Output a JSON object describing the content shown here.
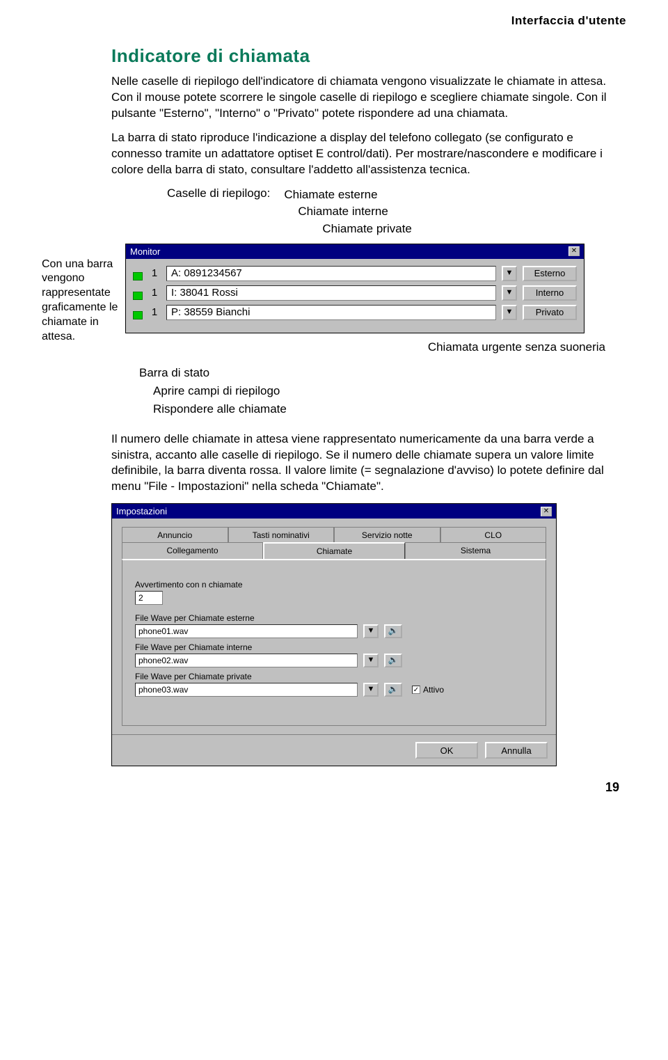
{
  "header": {
    "chapter": "Interfaccia d'utente"
  },
  "section": {
    "title": "Indicatore di chiamata"
  },
  "paragraph1": "Nelle caselle di riepilogo dell'indicatore di chiamata vengono visualizzate le chiamate in attesa. Con il mouse potete scorrere le singole caselle di riepilogo e scegliere chiamate singole. Con il pulsante \"Esterno\", \"Interno\" o \"Privato\" potete rispondere ad una chiamata.",
  "paragraph2": "La barra di stato riproduce l'indicazione a display del telefono collegato (se configurato e connesso tramite un adattatore optiset E control/dati). Per mostrare/nascondere e modificare i colore della barra di stato, consultare l'addetto all'assistenza tecnica.",
  "caselle": {
    "label": "Caselle di riepilogo:",
    "esterne": "Chiamate esterne",
    "interne": "Chiamate interne",
    "private": "Chiamate private"
  },
  "side_note": "Con una barra vengono rappresentate graficamente le chiamate in attesa.",
  "monitor": {
    "title": "Monitor",
    "close_glyph": "✕",
    "dd_glyph": "▼",
    "rows": [
      {
        "count": "1",
        "text": "A: 0891234567",
        "button": "Esterno"
      },
      {
        "count": "1",
        "text": "I: 38041   Rossi",
        "button": "Interno"
      },
      {
        "count": "1",
        "text": "P: 38559  Bianchi",
        "button": "Privato"
      }
    ],
    "urgent_label": "Chiamata urgente senza suoneria"
  },
  "below": {
    "l1": "Barra di stato",
    "l2": "Aprire campi di riepilogo",
    "l3": "Rispondere alle chiamate"
  },
  "paragraph3": "Il numero delle chiamate in attesa viene rappresentato numericamente da una barra verde a sinistra, accanto alle caselle di riepilogo. Se il numero delle chiamate supera un valore limite definibile, la barra diventa rossa. Il valore limite (= segnalazione d'avviso) lo potete definire dal menu \"File - Impostazioni\" nella scheda \"Chiamate\".",
  "settings": {
    "title": "Impostazioni",
    "close_glyph": "✕",
    "dd_glyph": "▼",
    "sound_glyph": "🔊",
    "tabs_row1": [
      "Annuncio",
      "Tasti nominativi",
      "Servizio notte",
      "CLO"
    ],
    "tabs_row2": [
      "Collegamento",
      "Chiamate",
      "Sistema"
    ],
    "warn_label": "Avvertimento con n chiamate",
    "warn_value": "2",
    "wave_ext_label": "File Wave per Chiamate esterne",
    "wave_ext_value": "phone01.wav",
    "wave_int_label": "File Wave per Chiamate interne",
    "wave_int_value": "phone02.wav",
    "wave_prv_label": "File Wave per Chiamate private",
    "wave_prv_value": "phone03.wav",
    "chk_active": "Attivo",
    "chk_mark": "✓",
    "ok": "OK",
    "cancel": "Annulla"
  },
  "page_number": "19"
}
